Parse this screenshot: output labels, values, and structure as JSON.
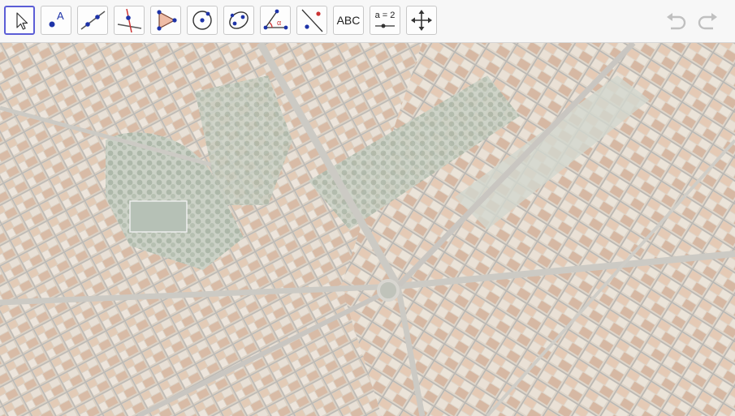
{
  "toolbar": {
    "tools": [
      {
        "name": "move",
        "icon": "cursor-arrow-icon",
        "selected": true
      },
      {
        "name": "point",
        "icon": "point-with-label-icon"
      },
      {
        "name": "line",
        "icon": "line-through-two-points-icon"
      },
      {
        "name": "perpendicular-line",
        "icon": "perpendicular-line-icon"
      },
      {
        "name": "polygon",
        "icon": "polygon-icon"
      },
      {
        "name": "circle",
        "icon": "circle-with-center-icon"
      },
      {
        "name": "ellipse",
        "icon": "ellipse-icon"
      },
      {
        "name": "angle",
        "icon": "angle-icon"
      },
      {
        "name": "reflect",
        "icon": "reflect-about-line-icon"
      },
      {
        "name": "text",
        "icon": "text-icon",
        "label": "ABC"
      },
      {
        "name": "slider",
        "icon": "slider-icon",
        "label": "a = 2"
      },
      {
        "name": "move-graphics-view",
        "icon": "move-graphics-view-icon"
      }
    ],
    "undo": {
      "icon": "undo-icon",
      "enabled": false
    },
    "redo": {
      "icon": "redo-icon",
      "enabled": false
    }
  },
  "canvas": {
    "background": "aerial-city-map-image"
  },
  "colors": {
    "accent": "#5b5dd6",
    "point": "#1e33a8",
    "line": "#555555",
    "angle_red": "#cc3333",
    "polygon_fill": "#e8a080",
    "disabled_icon": "#c0c0c0"
  }
}
